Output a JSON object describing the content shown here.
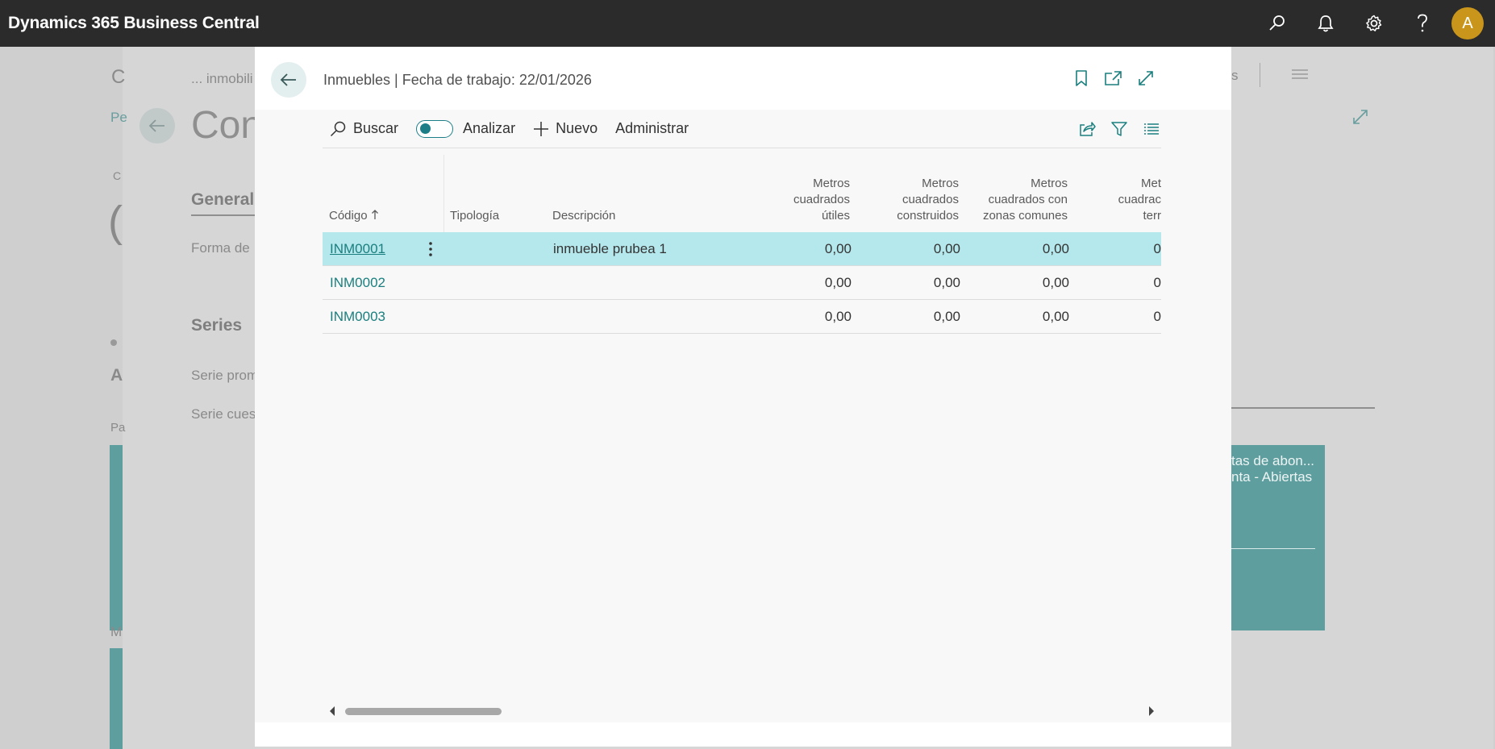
{
  "app": {
    "title": "Dynamics 365 Business Central",
    "avatar_initial": "A",
    "accent": "#1b7f7f"
  },
  "topbar_icons": [
    "search-icon",
    "bell-icon",
    "gear-icon",
    "help-icon"
  ],
  "background_page": {
    "breadcrumb": "... inmobili",
    "heading": "Con",
    "section_general": "General",
    "field_forma": "Forma de",
    "section_series": "Series",
    "field_serie_prom": "Serie prom",
    "field_serie_cues": "Serie cues",
    "tile_text_1": "tas de abon...",
    "tile_text_2": "nta - Abiertas",
    "frag_c": "C",
    "frag_pe": "Pe",
    "frag_ca": "C",
    "frag_paren": "(",
    "frag_a": "A",
    "frag_pa": "Pa",
    "frag_m": "M",
    "frag_s": "s"
  },
  "modal": {
    "title": "Inmuebles | Fecha de trabajo: 22/01/2026",
    "actions": {
      "search": "Buscar",
      "analyze": "Analizar",
      "new": "Nuevo",
      "manage": "Administrar"
    },
    "columns": {
      "code": "Código",
      "typology": "Tipología",
      "description": "Descripción",
      "useful_l1": "Metros",
      "useful_l2": "cuadrados",
      "useful_l3": "útiles",
      "built_l1": "Metros",
      "built_l2": "cuadrados",
      "built_l3": "construidos",
      "common_l1": "Metros",
      "common_l2": "cuadrados con",
      "common_l3": "zonas comunes",
      "land_l1": "Met",
      "land_l2": "cuadrac",
      "land_l3": "terr"
    },
    "rows": [
      {
        "code": "INM0001",
        "typology": "",
        "description": "inmueble prubea 1",
        "useful": "0,00",
        "built": "0,00",
        "common": "0,00",
        "land": "0"
      },
      {
        "code": "INM0002",
        "typology": "",
        "description": "",
        "useful": "0,00",
        "built": "0,00",
        "common": "0,00",
        "land": "0"
      },
      {
        "code": "INM0003",
        "typology": "",
        "description": "",
        "useful": "0,00",
        "built": "0,00",
        "common": "0,00",
        "land": "0"
      }
    ]
  }
}
